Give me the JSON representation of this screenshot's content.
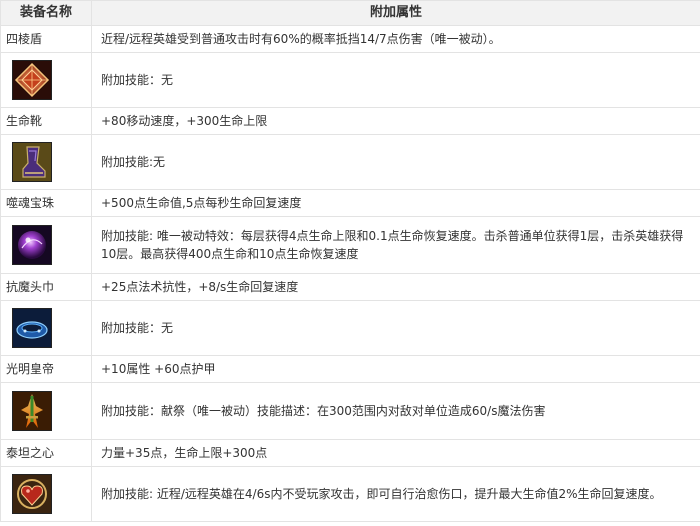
{
  "header": {
    "col_name": "装备名称",
    "col_attr": "附加属性"
  },
  "items": [
    {
      "name": "四棱盾",
      "attr": "近程/远程英雄受到普通攻击时有60%的概率抵挡14/7点伤害（唯一被动）。",
      "skill": "附加技能：无",
      "icon": "red-diamond-shield-icon"
    },
    {
      "name": "生命靴",
      "attr": "+80移动速度，+300生命上限",
      "skill": "附加技能:无",
      "icon": "purple-boots-icon"
    },
    {
      "name": "噬魂宝珠",
      "attr": "+500点生命值,5点每秒生命回复速度",
      "skill": "附加技能: 唯一被动特效：每层获得4点生命上限和0.1点生命恢复速度。击杀普通单位获得1层，击杀英雄获得10层。最高获得400点生命和10点生命恢复速度",
      "icon": "purple-orb-icon"
    },
    {
      "name": "抗魔头巾",
      "attr": "+25点法术抗性，+8/s生命回复速度",
      "skill": "附加技能：无",
      "icon": "blue-headband-icon"
    },
    {
      "name": "光明皇帝",
      "attr": "+10属性 +60点护甲",
      "skill": "附加技能：献祭（唯一被动）技能描述：在300范围内对敌对单位造成60/s魔法伤害",
      "icon": "flame-sword-icon"
    },
    {
      "name": "泰坦之心",
      "attr": "力量+35点，生命上限+300点",
      "skill": "附加技能: 近程/远程英雄在4/6s内不受玩家攻击，即可自行治愈伤口，提升最大生命值2%生命回复速度。",
      "icon": "titan-heart-icon"
    }
  ],
  "colors": {
    "header_bg": "#f2f2f2",
    "border": "#e3e3e3",
    "text": "#333333"
  }
}
